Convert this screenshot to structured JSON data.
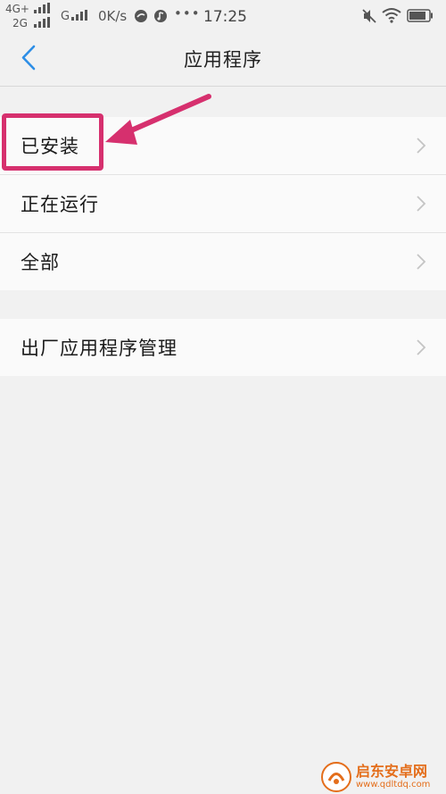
{
  "status_bar": {
    "net1": "4G+",
    "net2": "2G",
    "net3": "G",
    "speed": "0K/s",
    "more": "•••",
    "time": "17:25"
  },
  "header": {
    "title": "应用程序"
  },
  "groups": [
    {
      "items": [
        {
          "label": "已安装"
        },
        {
          "label": "正在运行"
        },
        {
          "label": "全部"
        }
      ]
    },
    {
      "items": [
        {
          "label": "出厂应用程序管理"
        }
      ]
    }
  ],
  "annotation": {
    "color": "#d6306e"
  },
  "watermark": {
    "name": "启东安卓网",
    "url": "www.qdltdq.com"
  },
  "colors": {
    "accent_blue": "#2d8ee6",
    "background": "#f1f1f1",
    "list_bg": "#fafafa"
  }
}
